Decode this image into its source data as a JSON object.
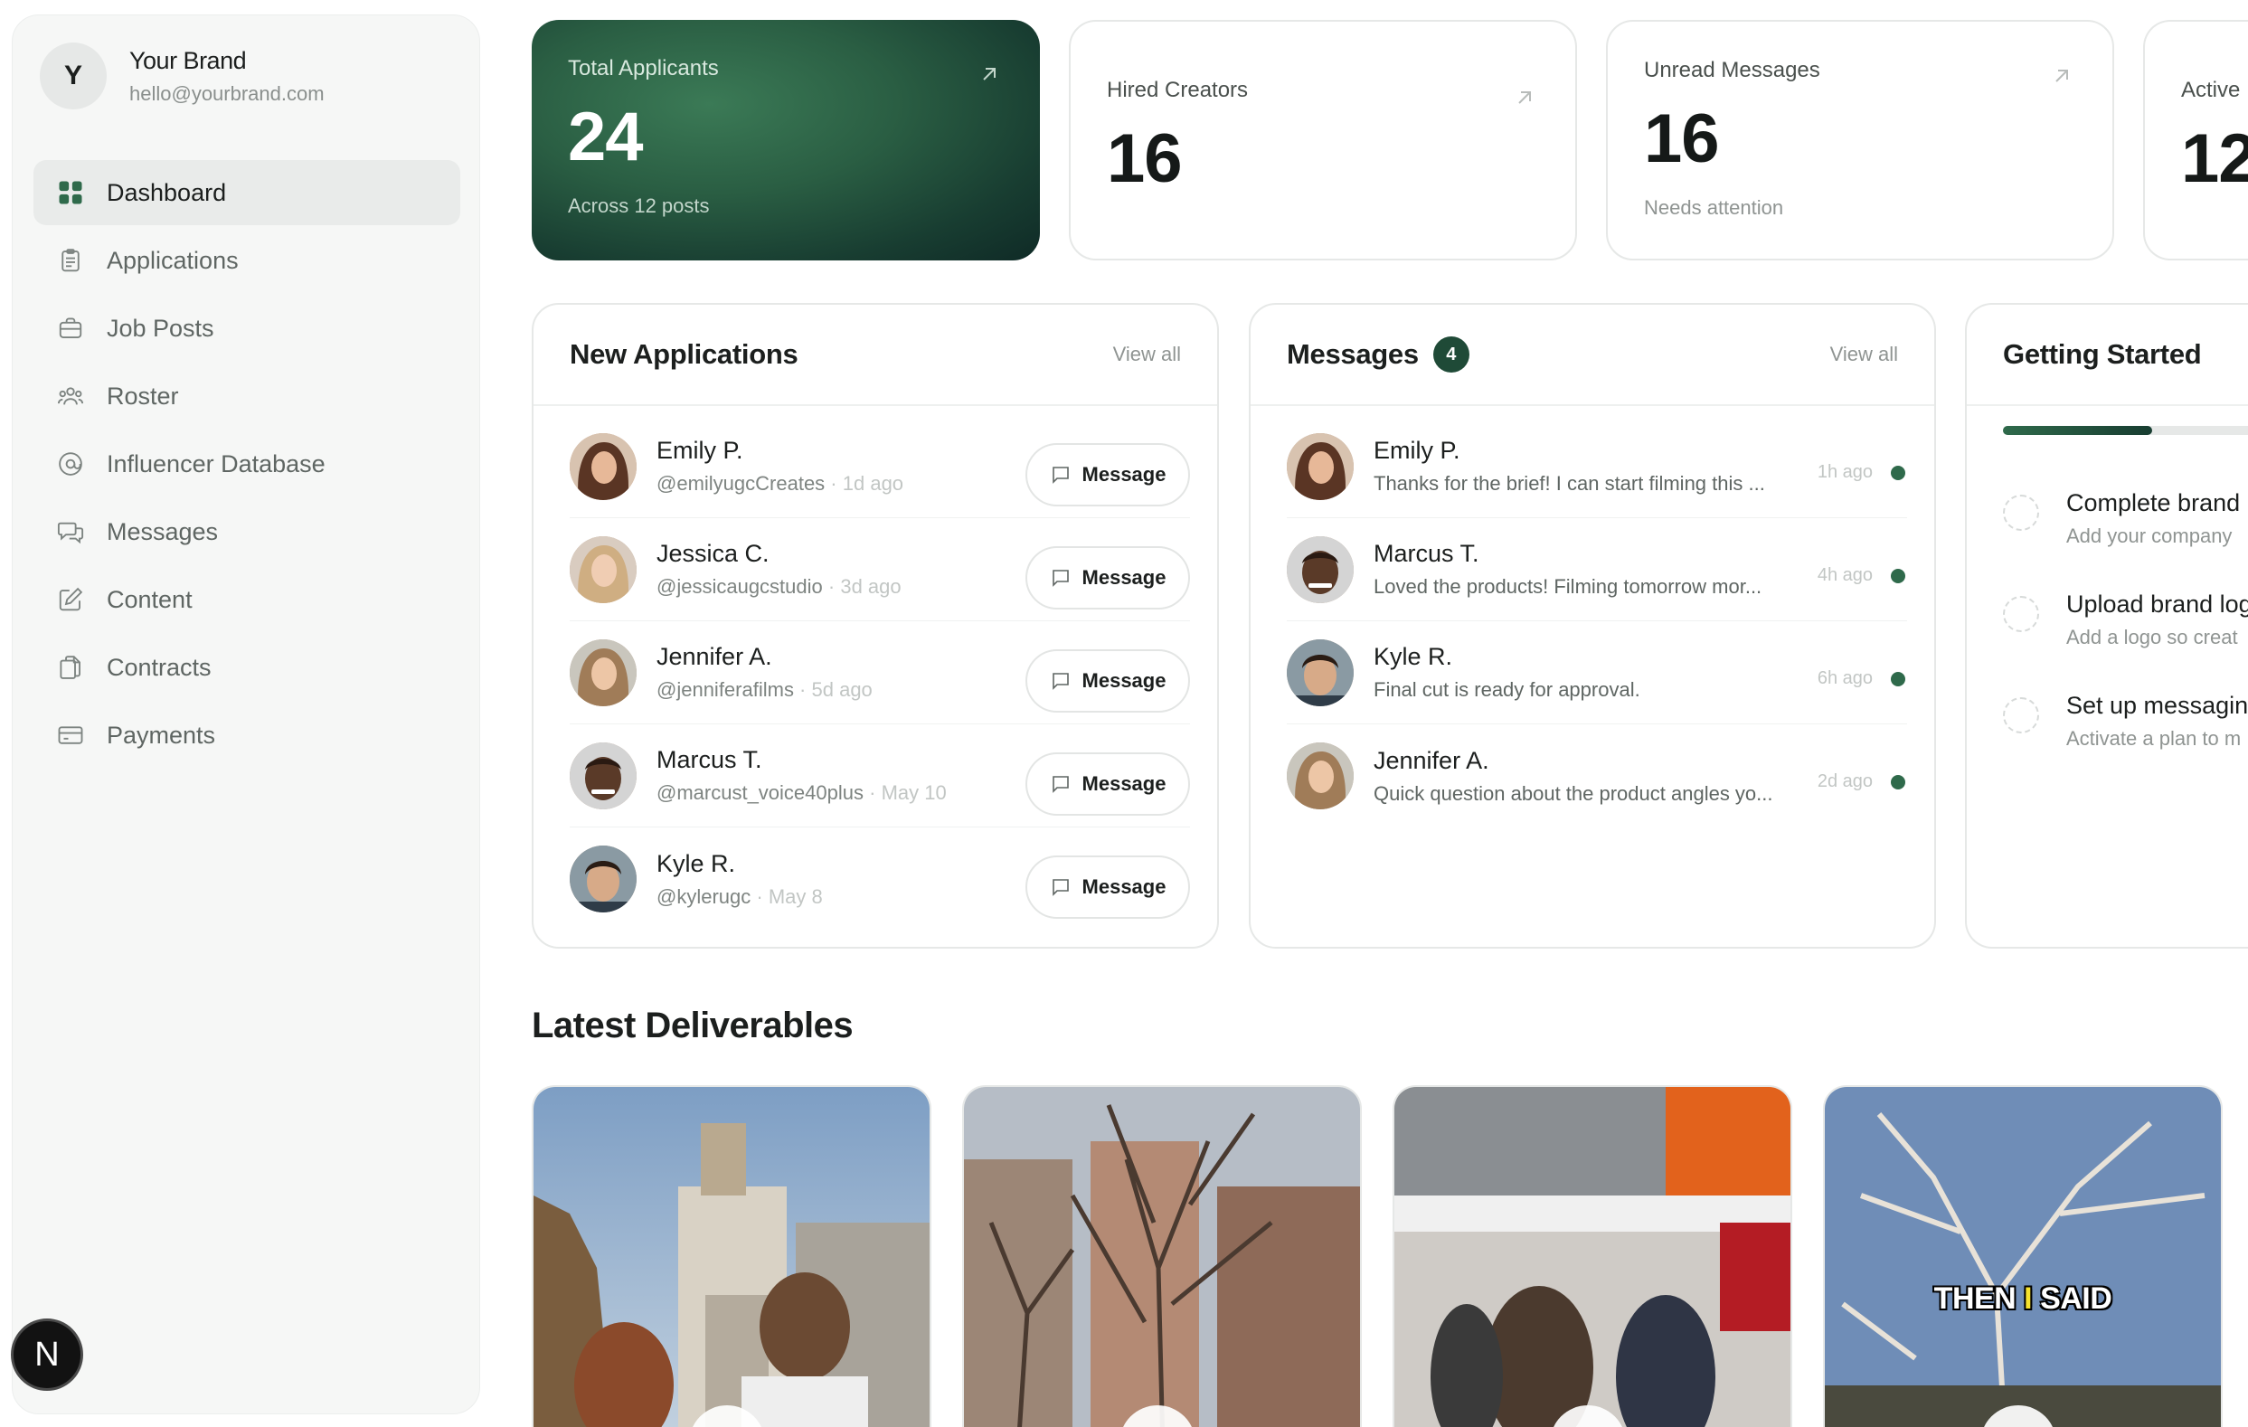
{
  "brand": {
    "initial": "Y",
    "name": "Your Brand",
    "email": "hello@yourbrand.com"
  },
  "nav": [
    {
      "label": "Dashboard",
      "icon": "grid-icon",
      "active": true
    },
    {
      "label": "Applications",
      "icon": "clipboard-icon"
    },
    {
      "label": "Job Posts",
      "icon": "briefcase-icon"
    },
    {
      "label": "Roster",
      "icon": "users-icon"
    },
    {
      "label": "Influencer Database",
      "icon": "at-sign-icon"
    },
    {
      "label": "Messages",
      "icon": "chat-bubbles-icon"
    },
    {
      "label": "Content",
      "icon": "edit-icon"
    },
    {
      "label": "Contracts",
      "icon": "document-copy-icon"
    },
    {
      "label": "Payments",
      "icon": "credit-card-icon"
    }
  ],
  "floating_badge": "N",
  "stats": [
    {
      "label": "Total Applicants",
      "value": "24",
      "sub": "Across 12 posts"
    },
    {
      "label": "Hired Creators",
      "value": "16",
      "sub": ""
    },
    {
      "label": "Unread Messages",
      "value": "16",
      "sub": "Needs attention"
    },
    {
      "label": "Active",
      "value": "12",
      "sub": ""
    }
  ],
  "applications": {
    "title": "New Applications",
    "view_all": "View all",
    "button_label": "Message",
    "items": [
      {
        "name": "Emily P.",
        "handle": "@emilyugcCreates",
        "time": "1d ago"
      },
      {
        "name": "Jessica C.",
        "handle": "@jessicaugcstudio",
        "time": "3d ago"
      },
      {
        "name": "Jennifer A.",
        "handle": "@jenniferafilms",
        "time": "5d ago"
      },
      {
        "name": "Marcus T.",
        "handle": "@marcust_voice40plus",
        "time": "May 10"
      },
      {
        "name": "Kyle R.",
        "handle": "@kylerugc",
        "time": "May 8"
      }
    ]
  },
  "messages": {
    "title": "Messages",
    "count": "4",
    "view_all": "View all",
    "items": [
      {
        "name": "Emily P.",
        "preview": "Thanks for the brief! I can start filming this ...",
        "time": "1h ago"
      },
      {
        "name": "Marcus T.",
        "preview": "Loved the products! Filming tomorrow mor...",
        "time": "4h ago"
      },
      {
        "name": "Kyle R.",
        "preview": "Final cut is ready for approval.",
        "time": "6h ago"
      },
      {
        "name": "Jennifer A.",
        "preview": "Quick question about the product angles yo...",
        "time": "2d ago"
      }
    ]
  },
  "getting_started": {
    "title": "Getting Started",
    "progress": 0.55,
    "tasks": [
      {
        "title": "Complete brand",
        "sub": "Add your company"
      },
      {
        "title": "Upload brand log",
        "sub": "Add a logo so creat"
      },
      {
        "title": "Set up messagin",
        "sub": "Activate a plan to m"
      }
    ]
  },
  "deliverables": {
    "title": "Latest Deliverables",
    "items": [
      {
        "caption": ""
      },
      {
        "caption": ""
      },
      {
        "caption": ""
      },
      {
        "caption_a": "THEN ",
        "caption_b": "I",
        "caption_c": " SAID"
      }
    ]
  },
  "colors": {
    "accent": "#2f6a4b",
    "accent_dark": "#183d31",
    "sidebar_bg": "#f6f7f6"
  }
}
